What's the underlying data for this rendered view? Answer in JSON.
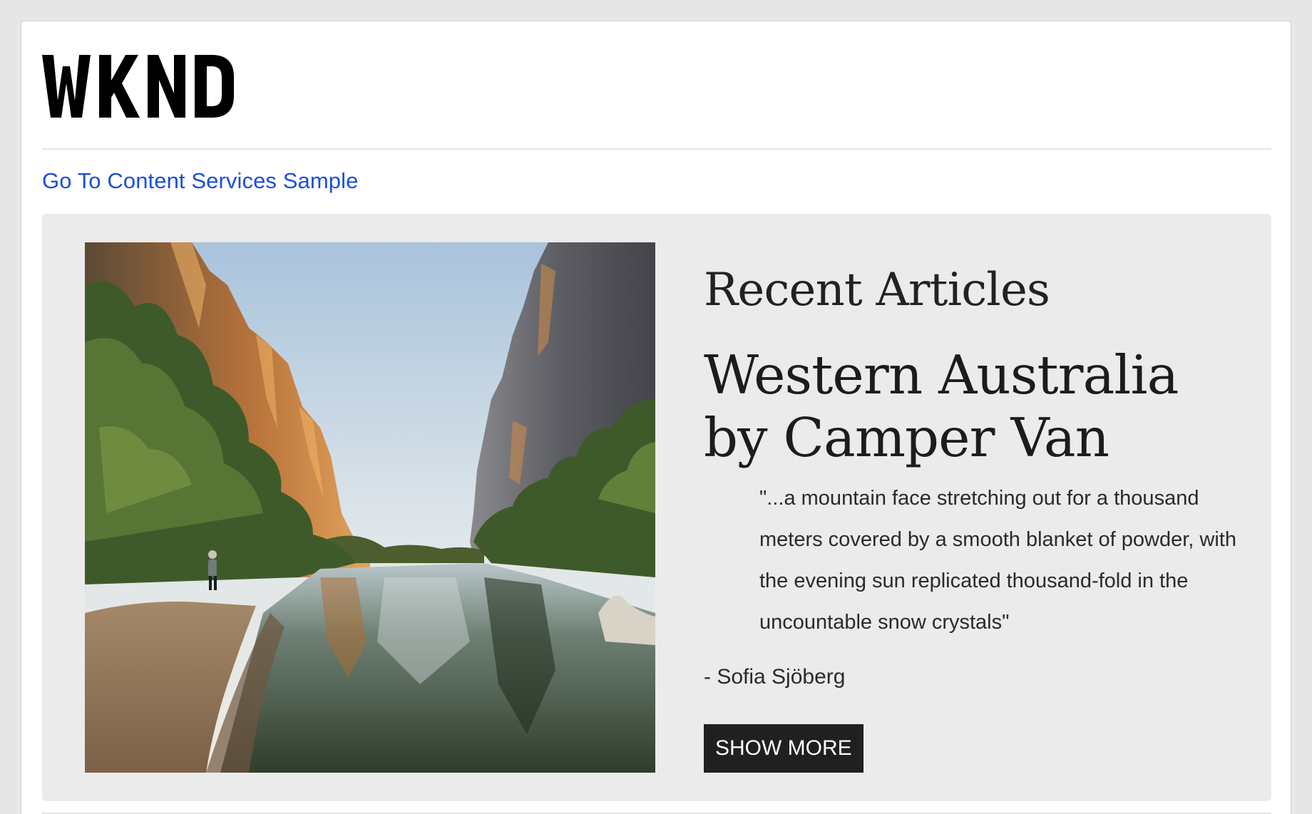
{
  "header": {
    "logo_text": "WKND"
  },
  "nav": {
    "content_services_link": "Go To Content Services Sample"
  },
  "teaser": {
    "section_title": "Recent Articles",
    "article_title": "Western Australia by Camper Van",
    "quote": "\"...a mountain face stretching out for a thousand meters covered by a smooth blanket of powder, with the evening sun replicated thousand-fold in the uncountable snow crystals\"",
    "author": "- Sofia Sjöberg",
    "button_label": "SHOW MORE",
    "image_subject": "gorge-river-landscape"
  },
  "colors": {
    "link": "#1a4fd9",
    "button_bg": "#202020",
    "panel_bg": "#ebebeb",
    "page_bg": "#e6e6e6"
  }
}
